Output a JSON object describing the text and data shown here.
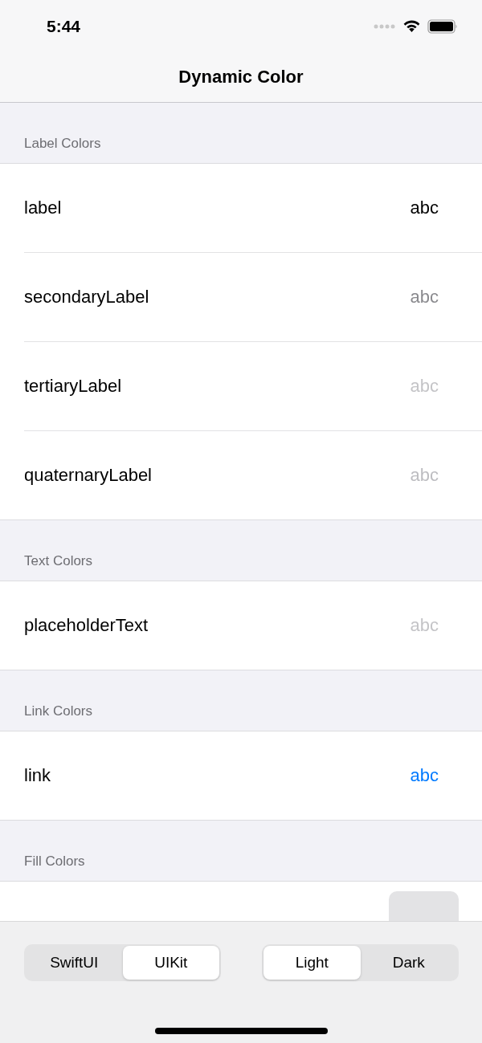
{
  "status_bar": {
    "time": "5:44"
  },
  "nav": {
    "title": "Dynamic Color"
  },
  "sections": [
    {
      "header": "Label Colors",
      "rows": [
        {
          "name": "label",
          "sample": {
            "kind": "text",
            "text": "abc",
            "color": "#000000"
          }
        },
        {
          "name": "secondaryLabel",
          "sample": {
            "kind": "text",
            "text": "abc",
            "color": "#8a8a8e"
          }
        },
        {
          "name": "tertiaryLabel",
          "sample": {
            "kind": "text",
            "text": "abc",
            "color": "#c4c4c7"
          }
        },
        {
          "name": "quaternaryLabel",
          "sample": {
            "kind": "text",
            "text": "abc",
            "color": "#bdbdc1"
          }
        }
      ]
    },
    {
      "header": "Text Colors",
      "rows": [
        {
          "name": "placeholderText",
          "sample": {
            "kind": "text",
            "text": "abc",
            "color": "#c4c4c7"
          }
        }
      ]
    },
    {
      "header": "Link Colors",
      "rows": [
        {
          "name": "link",
          "sample": {
            "kind": "text",
            "text": "abc",
            "color": "#007aff"
          }
        }
      ]
    },
    {
      "header": "Fill Colors",
      "rows": [
        {
          "sample": {
            "kind": "swatch",
            "color": "#e3e3e5"
          }
        }
      ]
    }
  ],
  "toolbar": {
    "segments": [
      [
        {
          "label": "SwiftUI",
          "selected": false
        },
        {
          "label": "UIKit",
          "selected": true
        }
      ],
      [
        {
          "label": "Light",
          "selected": true
        },
        {
          "label": "Dark",
          "selected": false
        }
      ]
    ]
  }
}
